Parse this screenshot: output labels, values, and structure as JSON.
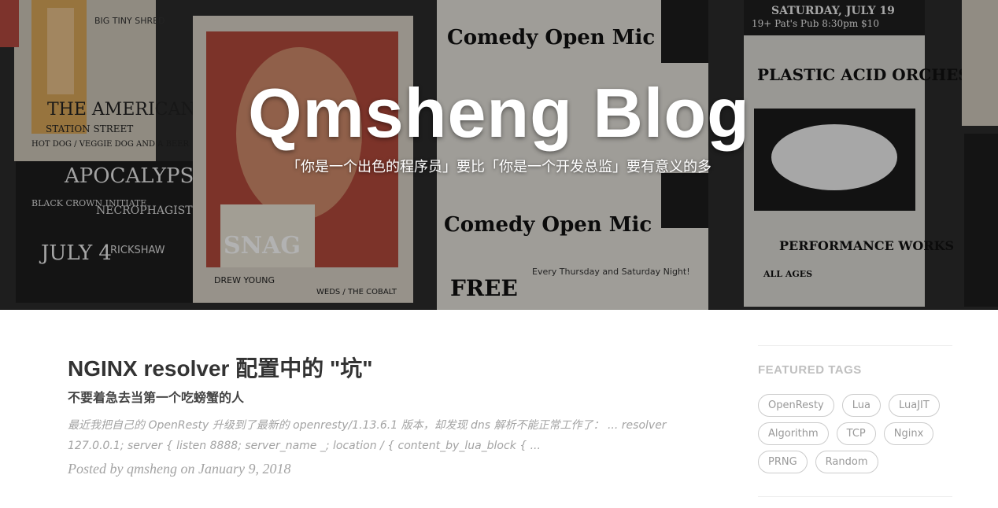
{
  "header": {
    "title": "Qmsheng Blog",
    "subtitle": "「你是一个出色的程序员」要比「你是一个开发总监」要有意义的多",
    "background": {
      "poster_texts": {
        "p1": "BIG TINY SHRED",
        "p2": "THE AMERICAN",
        "p3": "STATION STREET",
        "p4": "HOT DOG / VEGGIE DOG AND A BEER",
        "p5": "APOCALYPSE",
        "p6": "BLACK CROWN INITIATE",
        "p7": "NECROPHAGIST",
        "p8": "JULY 4",
        "p9": "RICKSHAW",
        "p10": "SNAG",
        "p11": "DREW YOUNG",
        "p12": "WEDS / THE COBALT",
        "p13": "Comedy Open Mic",
        "p14": "Comedy Open Mic",
        "p15": "Every Thursday and Saturday Night!",
        "p16": "FREE",
        "p17": "SATURDAY, JULY 19",
        "p18": "19+  Pat's Pub  8:30pm  $10",
        "p19": "PLASTIC ACID ORCHESTRA",
        "p20": "PERFORMANCE WORKS",
        "p21": "ALL AGES"
      }
    }
  },
  "post": {
    "title": "NGINX resolver 配置中的 \"坑\"",
    "subtitle": "不要着急去当第一个吃螃蟹的人",
    "excerpt": "最近我把自己的 OpenResty 升级到了最新的 openresty/1.13.6.1 版本，却发现 dns 解析不能正常工作了：  ... resolver 127.0.0.1; server { listen 8888; server_name _; location / { content_by_lua_block { ...",
    "meta": "Posted by qmsheng on January 9, 2018"
  },
  "sidebar": {
    "heading": "FEATURED TAGS",
    "tags": [
      {
        "label": "OpenResty"
      },
      {
        "label": "Lua"
      },
      {
        "label": "LuaJIT"
      },
      {
        "label": "Algorithm"
      },
      {
        "label": "TCP"
      },
      {
        "label": "Nginx"
      },
      {
        "label": "PRNG"
      },
      {
        "label": "Random"
      }
    ]
  },
  "colors": {
    "text": "#404040",
    "muted": "#a3a3a3",
    "tag_border": "#cccccc",
    "heading_gray": "#bfbfbf"
  }
}
